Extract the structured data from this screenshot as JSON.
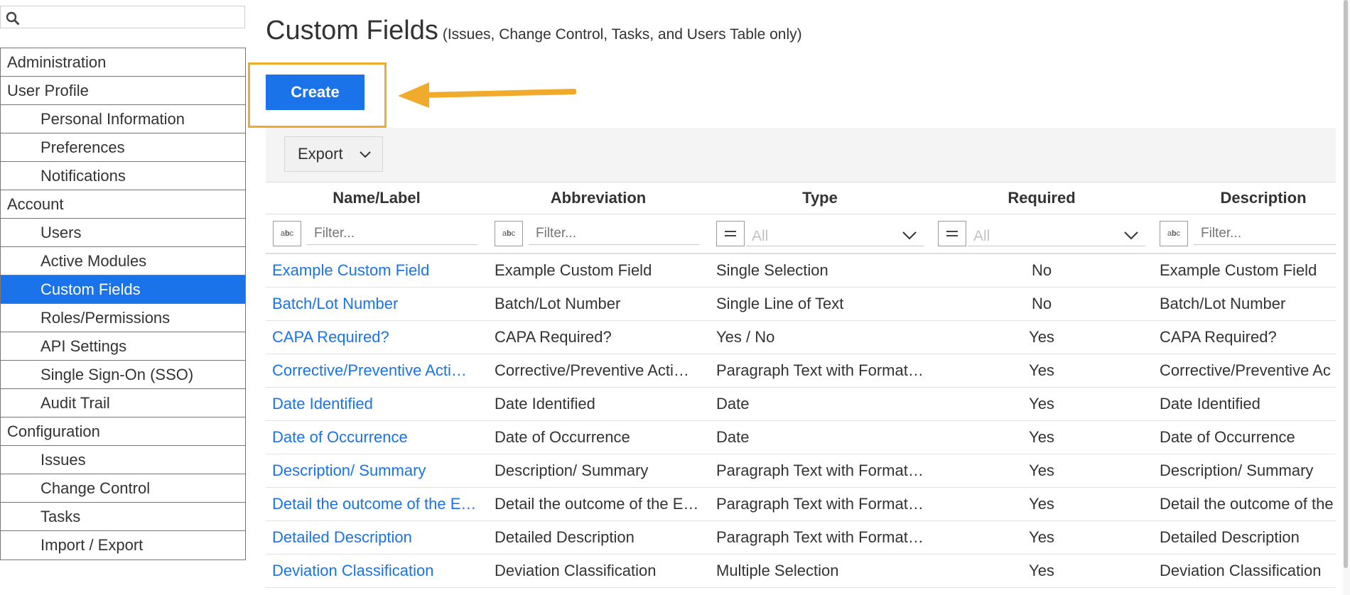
{
  "search": {
    "placeholder": ""
  },
  "sidebar": {
    "items": [
      {
        "label": "Administration",
        "level": "top",
        "key": "administration"
      },
      {
        "label": "User Profile",
        "level": "top",
        "key": "user-profile"
      },
      {
        "label": "Personal Information",
        "level": "sub",
        "key": "personal-information"
      },
      {
        "label": "Preferences",
        "level": "sub",
        "key": "preferences"
      },
      {
        "label": "Notifications",
        "level": "sub",
        "key": "notifications"
      },
      {
        "label": "Account",
        "level": "top",
        "key": "account"
      },
      {
        "label": "Users",
        "level": "sub",
        "key": "users"
      },
      {
        "label": "Active Modules",
        "level": "sub",
        "key": "active-modules"
      },
      {
        "label": "Custom Fields",
        "level": "sub",
        "key": "custom-fields",
        "active": true
      },
      {
        "label": "Roles/Permissions",
        "level": "sub",
        "key": "roles-permissions"
      },
      {
        "label": "API Settings",
        "level": "sub",
        "key": "api-settings"
      },
      {
        "label": "Single Sign-On (SSO)",
        "level": "sub",
        "key": "single-sign-on"
      },
      {
        "label": "Audit Trail",
        "level": "sub",
        "key": "audit-trail"
      },
      {
        "label": "Configuration",
        "level": "top",
        "key": "configuration"
      },
      {
        "label": "Issues",
        "level": "sub",
        "key": "issues"
      },
      {
        "label": "Change Control",
        "level": "sub",
        "key": "change-control"
      },
      {
        "label": "Tasks",
        "level": "sub",
        "key": "tasks"
      },
      {
        "label": "Import / Export",
        "level": "sub",
        "key": "import-export"
      }
    ]
  },
  "page": {
    "title": "Custom Fields",
    "subtitle": "(Issues, Change Control, Tasks, and Users Table only)",
    "create_label": "Create",
    "export_label": "Export"
  },
  "table": {
    "columns": [
      "Name/Label",
      "Abbreviation",
      "Type",
      "Required",
      "Description"
    ],
    "filter_placeholder": "Filter...",
    "select_all_label": "All",
    "rows": [
      {
        "name": "Example Custom Field",
        "abbr": "Example Custom Field",
        "type": "Single Selection",
        "required": "No",
        "desc": "Example Custom Field"
      },
      {
        "name": "Batch/Lot Number",
        "abbr": "Batch/Lot Number",
        "type": "Single Line of Text",
        "required": "No",
        "desc": "Batch/Lot Number"
      },
      {
        "name": "CAPA Required?",
        "abbr": "CAPA Required?",
        "type": "Yes / No",
        "required": "Yes",
        "desc": "CAPA Required?"
      },
      {
        "name": "Corrective/Preventive Acti…",
        "abbr": "Corrective/Preventive Acti…",
        "type": "Paragraph Text with Format…",
        "required": "Yes",
        "desc": "Corrective/Preventive Ac"
      },
      {
        "name": "Date Identified",
        "abbr": "Date Identified",
        "type": "Date",
        "required": "Yes",
        "desc": "Date Identified"
      },
      {
        "name": "Date of Occurrence",
        "abbr": "Date of Occurrence",
        "type": "Date",
        "required": "Yes",
        "desc": "Date of Occurrence"
      },
      {
        "name": "Description/ Summary",
        "abbr": "Description/ Summary",
        "type": "Paragraph Text with Format…",
        "required": "Yes",
        "desc": "Description/ Summary"
      },
      {
        "name": "Detail the outcome of the Ef…",
        "abbr": "Detail the outcome of the Ef…",
        "type": "Paragraph Text with Format…",
        "required": "Yes",
        "desc": "Detail the outcome of the"
      },
      {
        "name": "Detailed Description",
        "abbr": "Detailed Description",
        "type": "Paragraph Text with Format…",
        "required": "Yes",
        "desc": "Detailed Description"
      },
      {
        "name": "Deviation Classification",
        "abbr": "Deviation Classification",
        "type": "Multiple Selection",
        "required": "Yes",
        "desc": "Deviation Classification"
      }
    ]
  },
  "colors": {
    "accent": "#1a73e8",
    "highlight": "#f0ab2d",
    "text": "#333333"
  }
}
